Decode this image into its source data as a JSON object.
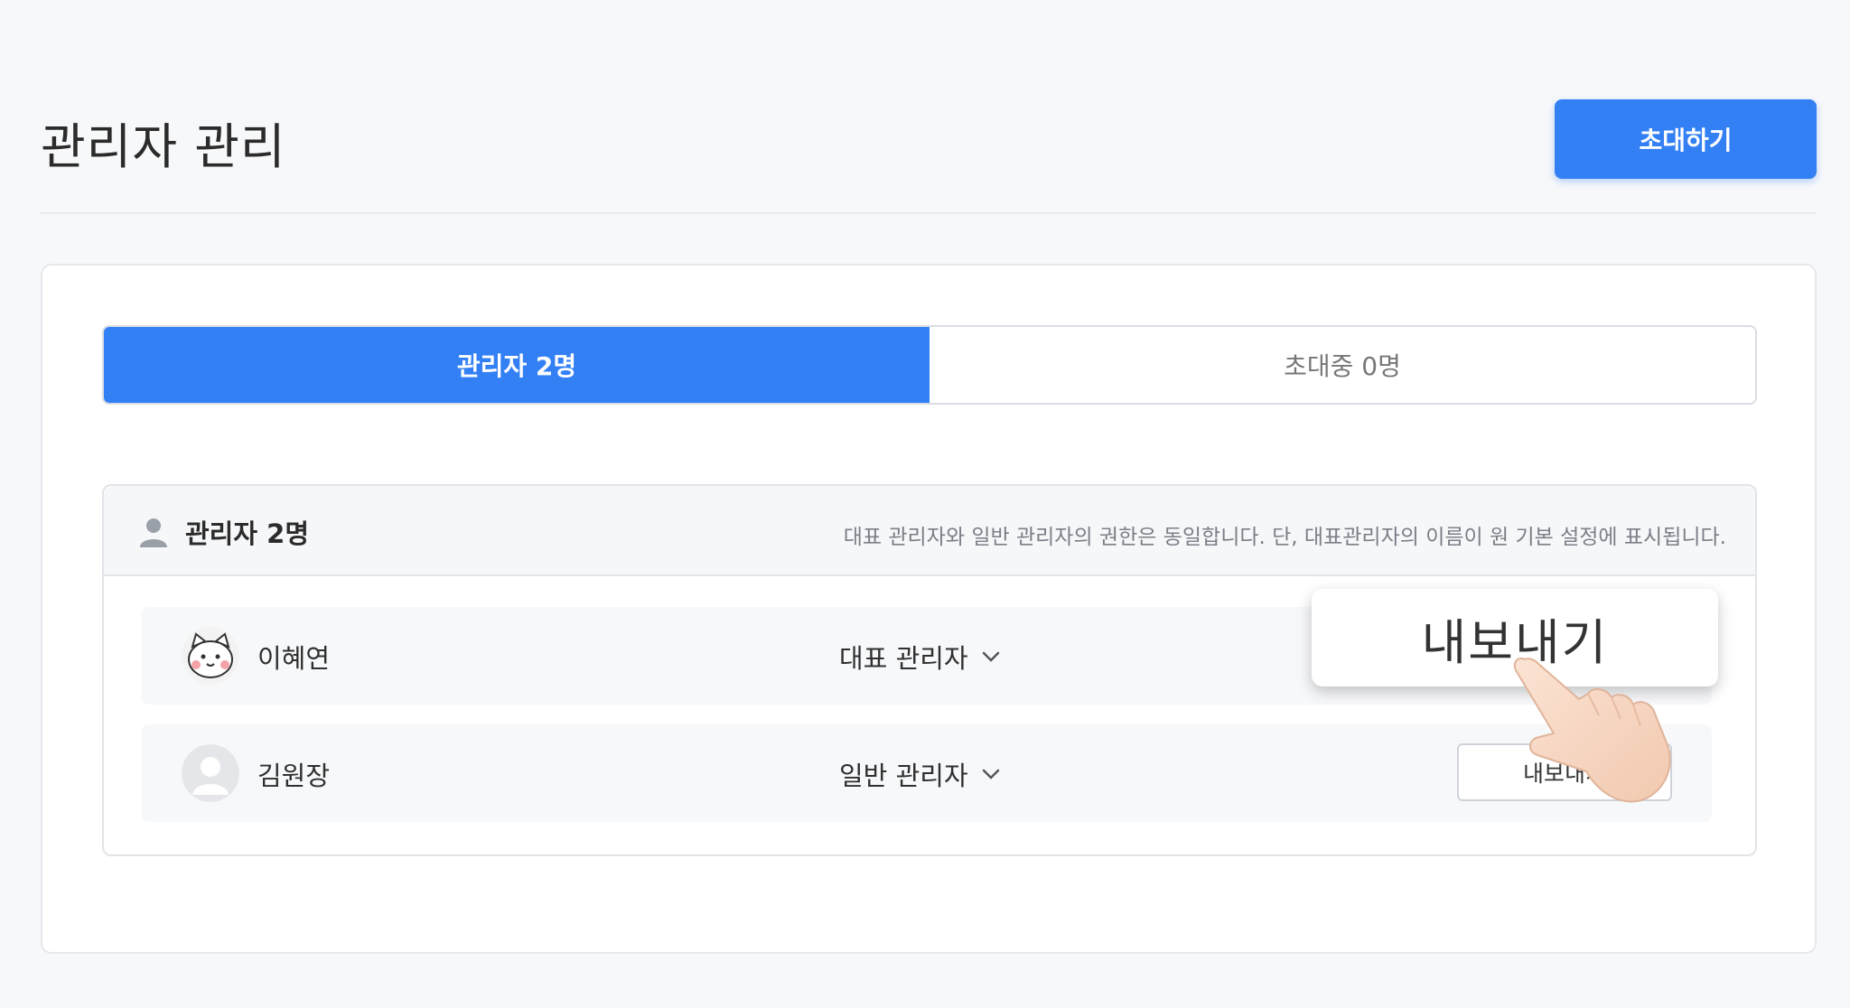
{
  "header": {
    "title": "관리자 관리",
    "invite_label": "초대하기"
  },
  "tabs": [
    {
      "label": "관리자 2명",
      "active": true
    },
    {
      "label": "초대중 0명",
      "active": false
    }
  ],
  "panel": {
    "title": "관리자 2명",
    "note": "대표 관리자와 일반 관리자의 권한은 동일합니다. 단, 대표관리자의 이름이 원 기본 설정에 표시됩니다."
  },
  "members": [
    {
      "name": "이혜연",
      "role": "대표 관리자",
      "avatar": "cat-avatar-icon"
    },
    {
      "name": "김원장",
      "role": "일반 관리자",
      "avatar": "default-user-avatar-icon",
      "action_label": "내보내기"
    }
  ],
  "callout": {
    "label": "내보내기"
  },
  "colors": {
    "accent": "#3380f5",
    "background": "#f7f8fa"
  }
}
